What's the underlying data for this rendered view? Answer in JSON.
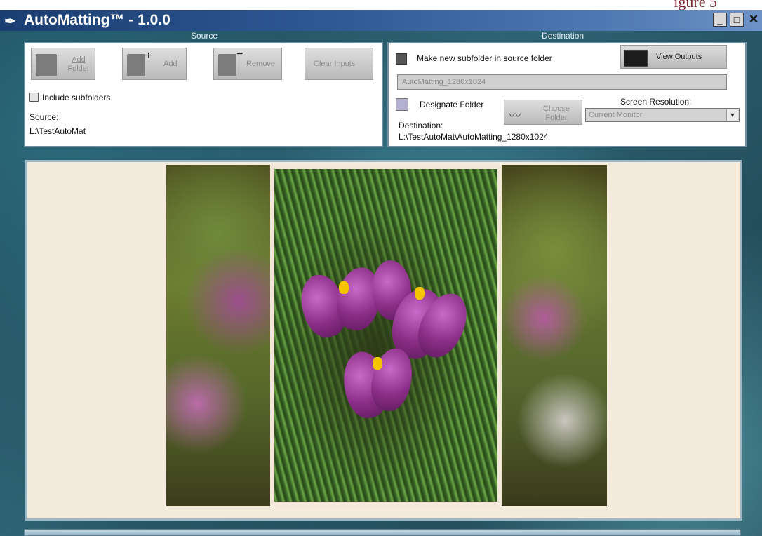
{
  "caption": "igure 5",
  "window": {
    "title": "AutoMatting™ - 1.0.0"
  },
  "sections": {
    "source": "Source",
    "destination": "Destination"
  },
  "source": {
    "add_folder": "Add Folder",
    "add": "Add",
    "remove": "Remove",
    "clear_inputs": "Clear Inputs",
    "include_subfolders": "Include subfolders",
    "source_label": "Source:",
    "source_path": "L:\\TestAutoMat"
  },
  "destination": {
    "make_subfolder": "Make new subfolder in source folder",
    "view_outputs": "View Outputs",
    "subfolder_name": "AutoMatting_1280x1024",
    "designate_folder": "Designate Folder",
    "choose_folder": "Choose Folder",
    "screen_resolution_label": "Screen Resolution:",
    "screen_resolution_value": "Current Monitor",
    "destination_label": "Destination:",
    "destination_path": "L:\\TestAutoMat\\AutoMatting_1280x1024"
  }
}
